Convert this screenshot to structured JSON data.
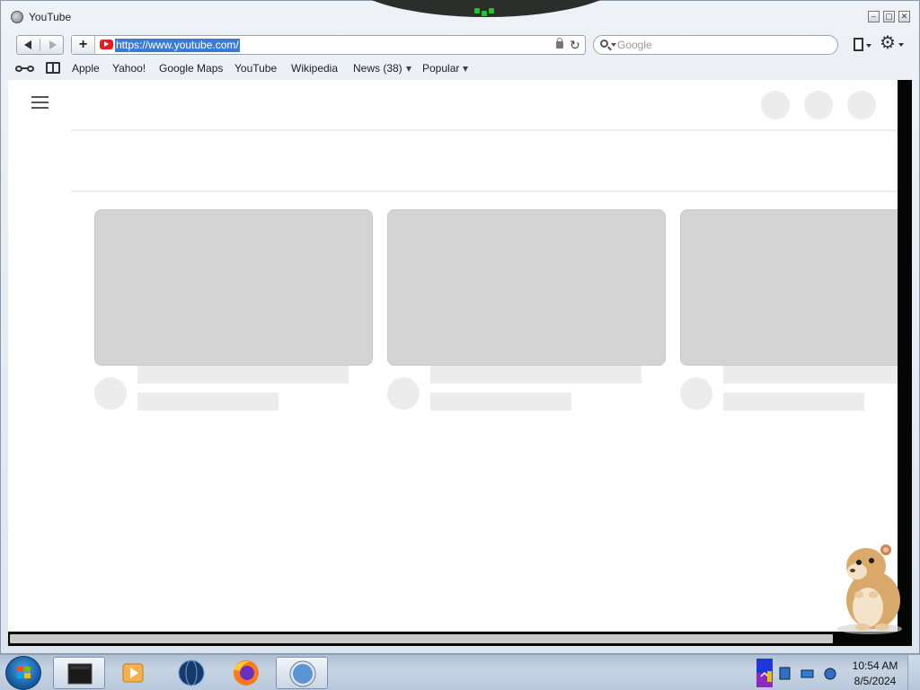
{
  "window": {
    "title": "YouTube"
  },
  "toolbar": {
    "url": "https://www.youtube.com/",
    "search_placeholder": "Google",
    "add_label": "+",
    "reload_glyph": "↻",
    "gear_glyph": "⚙"
  },
  "bookmarks": {
    "items": [
      "Apple",
      "Yahoo!",
      "Google Maps",
      "YouTube",
      "Wikipedia",
      "News (38)",
      "Popular"
    ]
  },
  "icons": {
    "title": "browser-globe-icon",
    "favicon": "youtube-icon",
    "reading_list": "glasses-icon",
    "bookmarks": "book-icon"
  },
  "colors": {
    "url_highlight": "#3a7bd5",
    "youtube_red": "#e02020",
    "skeleton": "#d4d4d4",
    "skeleton_light": "#ececec"
  },
  "taskbar": {
    "time": "10:54 AM",
    "date": "8/5/2024",
    "apps": [
      "terminal-icon",
      "media-player-icon",
      "globe-browser-icon",
      "firefox-icon",
      "safari-icon"
    ]
  }
}
